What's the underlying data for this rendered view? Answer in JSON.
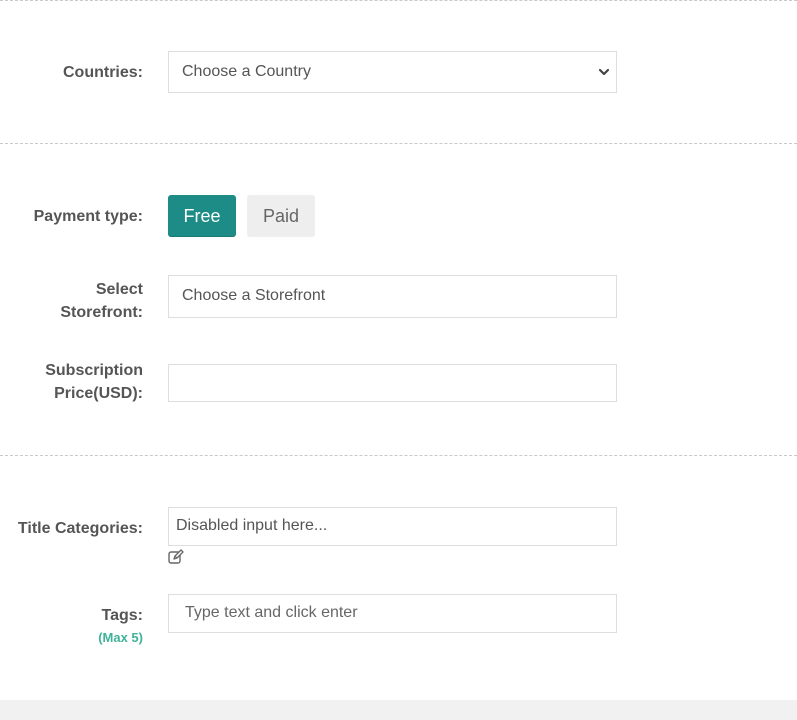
{
  "countries": {
    "label": "Countries:",
    "selected": "Choose a Country"
  },
  "payment": {
    "label": "Payment type:",
    "options": [
      "Free",
      "Paid"
    ],
    "active_option": "Free"
  },
  "storefront": {
    "label_line1": "Select",
    "label_line2": "Storefront:",
    "selected": "Choose a Storefront"
  },
  "subscription": {
    "label_line1": "Subscription",
    "label_line2": "Price(USD):",
    "value": ""
  },
  "title_categories": {
    "label": "Title Categories:",
    "placeholder": "Disabled input here..."
  },
  "tags": {
    "label": "Tags:",
    "note": "(Max 5)",
    "placeholder": "Type text and click enter"
  },
  "colors": {
    "accent": "#1e8c86",
    "note": "#3fb39a",
    "text": "#555555",
    "border": "#dedede"
  },
  "icons": {
    "select_arrow": "chevron-down-icon",
    "edit": "edit-icon"
  }
}
